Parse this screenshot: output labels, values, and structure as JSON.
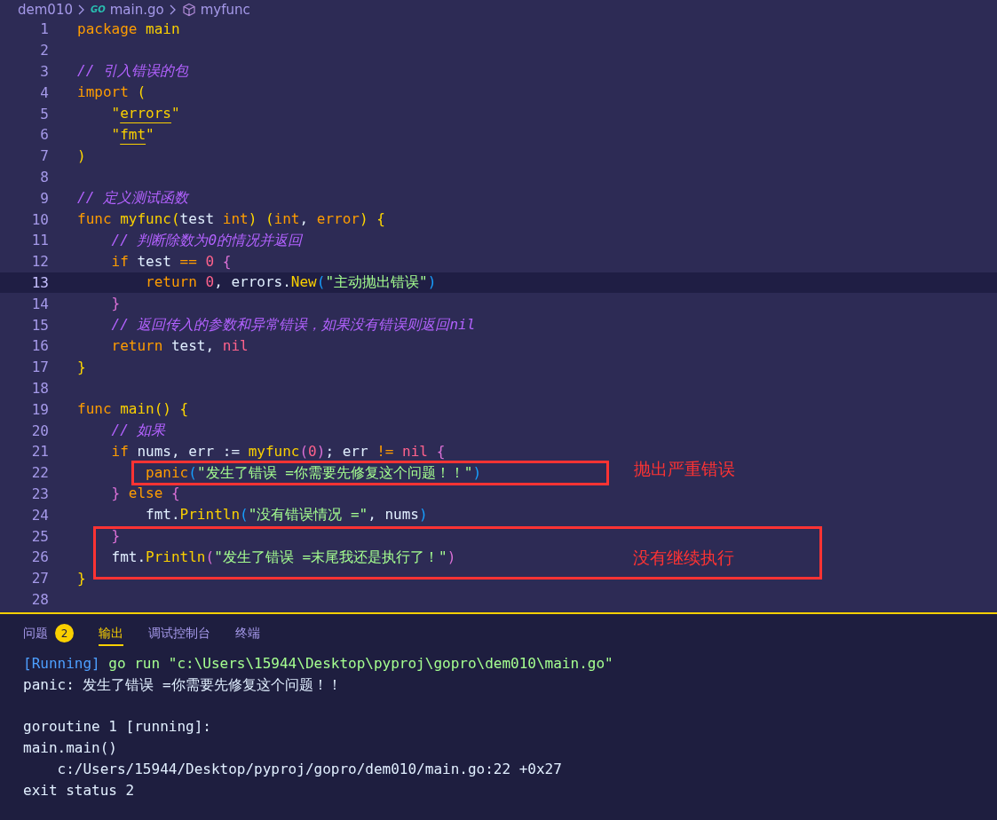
{
  "breadcrumb": [
    {
      "kind": "folder",
      "label": "dem010"
    },
    {
      "kind": "go-file",
      "label": "main.go",
      "icon_text": "GO"
    },
    {
      "kind": "symbol",
      "label": "myfunc"
    }
  ],
  "code_lines": [
    {
      "number": "1",
      "highlighted": false,
      "tokens": [
        {
          "kind": "kw",
          "text": "package "
        },
        {
          "kind": "fn",
          "text": "main"
        }
      ]
    },
    {
      "number": "2",
      "highlighted": false
    },
    {
      "number": "3",
      "highlighted": false,
      "tokens": [
        {
          "kind": "cmt",
          "text": "// 引入错误的包"
        }
      ]
    },
    {
      "number": "4",
      "highlighted": false,
      "tokens": [
        {
          "kind": "kw",
          "text": "import "
        },
        {
          "kind": "b1",
          "text": "("
        }
      ]
    },
    {
      "number": "5",
      "highlighted": false,
      "tokens": [
        {
          "kind": "quote",
          "text": "    \""
        },
        {
          "kind": "link",
          "text": "errors"
        },
        {
          "kind": "quote",
          "text": "\""
        }
      ]
    },
    {
      "number": "6",
      "highlighted": false,
      "tokens": [
        {
          "kind": "quote",
          "text": "    \""
        },
        {
          "kind": "link",
          "text": "fmt"
        },
        {
          "kind": "quote",
          "text": "\""
        }
      ]
    },
    {
      "number": "7",
      "highlighted": false,
      "tokens": [
        {
          "kind": "b1",
          "text": ")"
        }
      ]
    },
    {
      "number": "8",
      "highlighted": false
    },
    {
      "number": "9",
      "highlighted": false,
      "tokens": [
        {
          "kind": "cmt",
          "text": "// 定义测试函数"
        }
      ]
    },
    {
      "number": "10",
      "highlighted": false,
      "tokens": [
        {
          "kind": "kw",
          "text": "func "
        },
        {
          "kind": "fn",
          "text": "myfunc"
        },
        {
          "kind": "b1",
          "text": "("
        },
        {
          "kind": "plain",
          "text": "test "
        },
        {
          "kind": "kw",
          "text": "int"
        },
        {
          "kind": "b1",
          "text": ") ("
        },
        {
          "kind": "kw",
          "text": "int"
        },
        {
          "kind": "plain",
          "text": ", "
        },
        {
          "kind": "kw",
          "text": "error"
        },
        {
          "kind": "b1",
          "text": ") {"
        }
      ]
    },
    {
      "number": "11",
      "highlighted": false,
      "tokens": [
        {
          "kind": "cmt",
          "text": "    // 判断除数为0的情况并返回"
        }
      ]
    },
    {
      "number": "12",
      "highlighted": false,
      "tokens": [
        {
          "kind": "kw",
          "text": "    if "
        },
        {
          "kind": "plain",
          "text": "test "
        },
        {
          "kind": "kw",
          "text": "== "
        },
        {
          "kind": "num",
          "text": "0 "
        },
        {
          "kind": "b2",
          "text": "{"
        }
      ]
    },
    {
      "number": "13",
      "highlighted": true,
      "tokens": [
        {
          "kind": "kw",
          "text": "        return "
        },
        {
          "kind": "num",
          "text": "0"
        },
        {
          "kind": "plain",
          "text": ", errors."
        },
        {
          "kind": "fn",
          "text": "New"
        },
        {
          "kind": "b3",
          "text": "("
        },
        {
          "kind": "str",
          "text": "\"主动抛出错误\""
        },
        {
          "kind": "b3",
          "text": ")"
        }
      ]
    },
    {
      "number": "14",
      "highlighted": false,
      "tokens": [
        {
          "kind": "b2",
          "text": "    }"
        }
      ]
    },
    {
      "number": "15",
      "highlighted": false,
      "tokens": [
        {
          "kind": "cmt",
          "text": "    // 返回传入的参数和异常错误，如果没有错误则返回nil"
        }
      ]
    },
    {
      "number": "16",
      "highlighted": false,
      "tokens": [
        {
          "kind": "kw",
          "text": "    return "
        },
        {
          "kind": "plain",
          "text": "test, "
        },
        {
          "kind": "num",
          "text": "nil"
        }
      ]
    },
    {
      "number": "17",
      "highlighted": false,
      "tokens": [
        {
          "kind": "b1",
          "text": "}"
        }
      ]
    },
    {
      "number": "18",
      "highlighted": false
    },
    {
      "number": "19",
      "highlighted": false,
      "tokens": [
        {
          "kind": "kw",
          "text": "func "
        },
        {
          "kind": "fn",
          "text": "main"
        },
        {
          "kind": "b1",
          "text": "() {"
        }
      ]
    },
    {
      "number": "20",
      "highlighted": false,
      "tokens": [
        {
          "kind": "cmt",
          "text": "    // 如果"
        }
      ]
    },
    {
      "number": "21",
      "highlighted": false,
      "tokens": [
        {
          "kind": "kw",
          "text": "    if "
        },
        {
          "kind": "plain",
          "text": "nums, err := "
        },
        {
          "kind": "fn",
          "text": "myfunc"
        },
        {
          "kind": "b2",
          "text": "("
        },
        {
          "kind": "num",
          "text": "0"
        },
        {
          "kind": "b2",
          "text": ")"
        },
        {
          "kind": "plain",
          "text": "; err "
        },
        {
          "kind": "kw",
          "text": "!= "
        },
        {
          "kind": "num",
          "text": "nil "
        },
        {
          "kind": "b2",
          "text": "{"
        }
      ]
    },
    {
      "number": "22",
      "highlighted": false,
      "tokens": [
        {
          "kind": "kw",
          "text": "        panic"
        },
        {
          "kind": "b3",
          "text": "("
        },
        {
          "kind": "str",
          "text": "\"发生了错误 =你需要先修复这个问题！！\""
        },
        {
          "kind": "b3",
          "text": ")"
        }
      ]
    },
    {
      "number": "23",
      "highlighted": false,
      "tokens": [
        {
          "kind": "b2",
          "text": "    }"
        },
        {
          "kind": "kw",
          "text": " else "
        },
        {
          "kind": "b2",
          "text": "{"
        }
      ]
    },
    {
      "number": "24",
      "highlighted": false,
      "tokens": [
        {
          "kind": "plain",
          "text": "        fmt."
        },
        {
          "kind": "fn",
          "text": "Println"
        },
        {
          "kind": "b3",
          "text": "("
        },
        {
          "kind": "str",
          "text": "\"没有错误情况 =\""
        },
        {
          "kind": "plain",
          "text": ", nums"
        },
        {
          "kind": "b3",
          "text": ")"
        }
      ]
    },
    {
      "number": "25",
      "highlighted": false,
      "tokens": [
        {
          "kind": "b2",
          "text": "    }"
        }
      ]
    },
    {
      "number": "26",
      "highlighted": false,
      "tokens": [
        {
          "kind": "plain",
          "text": "    fmt."
        },
        {
          "kind": "fn",
          "text": "Println"
        },
        {
          "kind": "b2",
          "text": "("
        },
        {
          "kind": "str",
          "text": "\"发生了错误 =末尾我还是执行了！\""
        },
        {
          "kind": "b2",
          "text": ")"
        }
      ]
    },
    {
      "number": "27",
      "highlighted": false,
      "tokens": [
        {
          "kind": "b1",
          "text": "}"
        }
      ]
    },
    {
      "number": "28",
      "highlighted": false
    }
  ],
  "annotations": [
    {
      "label": "抛出严重错误"
    },
    {
      "label": "没有继续执行"
    }
  ],
  "panel_tabs": [
    {
      "label": "问题",
      "badge": "2",
      "selected": false
    },
    {
      "label": "输出",
      "selected": true
    },
    {
      "label": "调试控制台",
      "selected": false
    },
    {
      "label": "终端",
      "selected": false
    }
  ],
  "output_lines": [
    {
      "kind": "text",
      "tokens": [
        {
          "kind": "status",
          "text": "[Running] "
        },
        {
          "kind": "command",
          "text": "go run \"c:\\Users\\15944\\Desktop\\pyproj\\gopro\\dem010\\main.go\""
        }
      ]
    },
    {
      "kind": "text",
      "tokens": [
        {
          "kind": "plain",
          "text": "panic: 发生了错误 =你需要先修复这个问题！！"
        }
      ]
    },
    {
      "kind": "blank"
    },
    {
      "kind": "text",
      "tokens": [
        {
          "kind": "plain",
          "text": "goroutine 1 [running]:"
        }
      ]
    },
    {
      "kind": "text",
      "tokens": [
        {
          "kind": "plain",
          "text": "main.main()"
        }
      ]
    },
    {
      "kind": "text",
      "tokens": [
        {
          "kind": "plain",
          "text": "    c:/Users/15944/Desktop/pyproj/gopro/dem010/main.go:22 +0x27"
        }
      ]
    },
    {
      "kind": "text",
      "tokens": [
        {
          "kind": "plain",
          "text": "exit status 2"
        }
      ]
    }
  ]
}
